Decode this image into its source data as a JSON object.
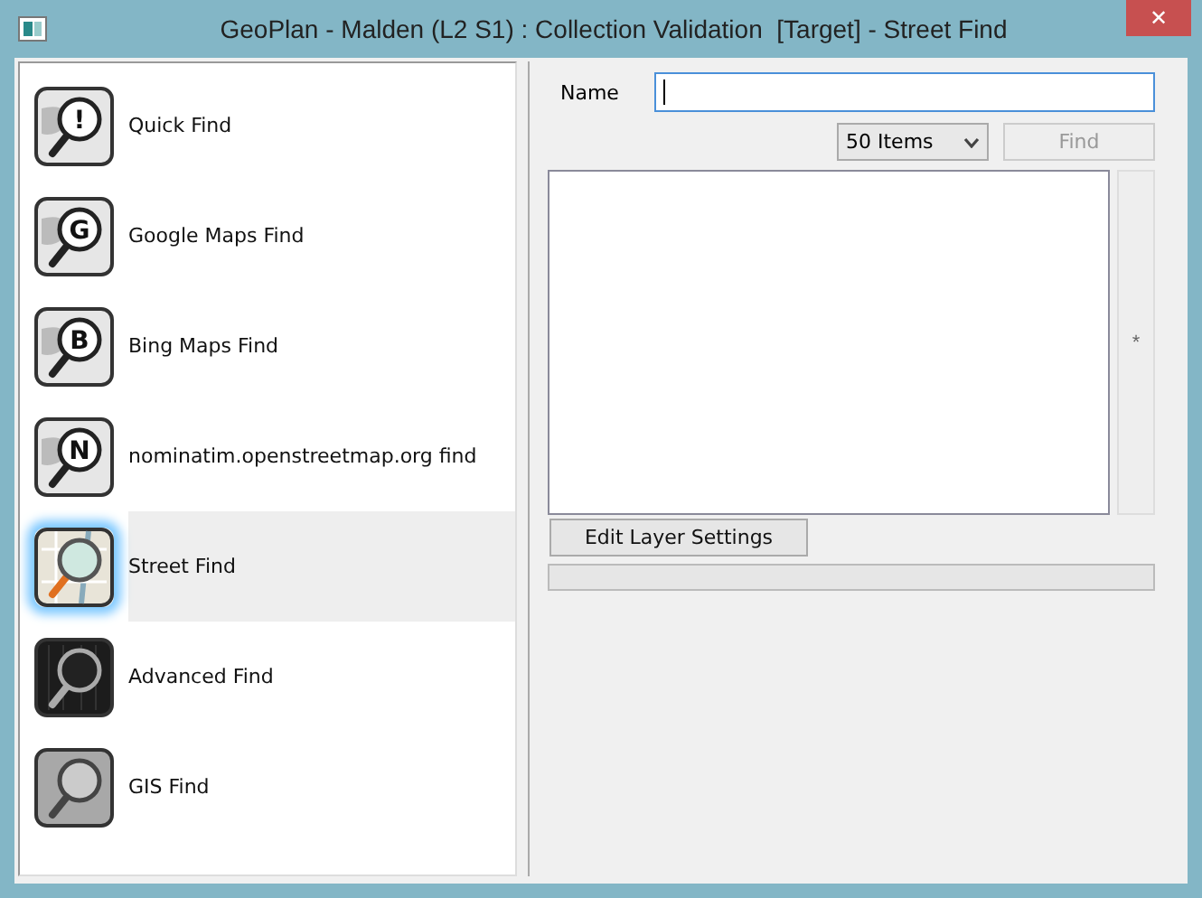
{
  "window": {
    "title": "GeoPlan - Malden (L2 S1) : Collection Validation  [Target] - Street Find",
    "close": "✕"
  },
  "finders": [
    {
      "label": "Quick Find",
      "kind": "letter",
      "glyph": "!",
      "selected": false
    },
    {
      "label": "Google Maps Find",
      "kind": "letter",
      "glyph": "G",
      "selected": false
    },
    {
      "label": "Bing Maps Find",
      "kind": "letter",
      "glyph": "B",
      "selected": false
    },
    {
      "label": "nominatim.openstreetmap.org find",
      "kind": "letter",
      "glyph": "N",
      "selected": false
    },
    {
      "label": "Street Find",
      "kind": "map",
      "selected": true
    },
    {
      "label": "Advanced Find",
      "kind": "dark",
      "selected": false
    },
    {
      "label": "GIS Find",
      "kind": "grey",
      "selected": false
    }
  ],
  "search": {
    "label": "Name",
    "focused": true,
    "limit": "50 Items",
    "find": {
      "label": "Find",
      "disabled": true
    }
  },
  "results": {
    "side_button": "*",
    "edit_button": "Edit Layer Settings",
    "progress": {
      "level": 0
    }
  }
}
